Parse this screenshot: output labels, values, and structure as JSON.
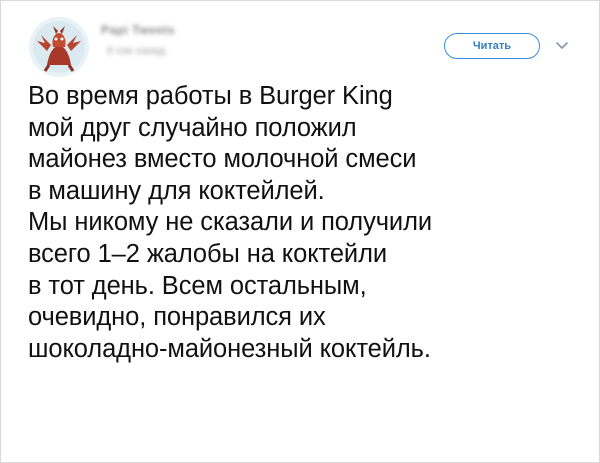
{
  "tweet": {
    "author": {
      "display_name": "Papi Tweets",
      "handle": "6 сек назад"
    },
    "follow_button_label": "Читать",
    "menu_icon": "chevron-down-icon",
    "avatar_icon": "dragon-avatar",
    "text_lines": [
      "Во время работы в Burger King",
      "мой друг случайно положил",
      "майонез вместо молочной смеси",
      "в машину для коктейлей.",
      "Мы никому не сказали и получили",
      "всего 1–2 жалобы на коктейли",
      "в тот день. Всем остальным,",
      "очевидно, понравился их",
      "шоколадно-майонезный коктейль."
    ]
  },
  "colors": {
    "accent": "#3b8fdc",
    "text": "#111111",
    "muted": "#8a8a8a",
    "avatar_bg": "#e9f2f7",
    "avatar_figure": "#b5432c"
  }
}
